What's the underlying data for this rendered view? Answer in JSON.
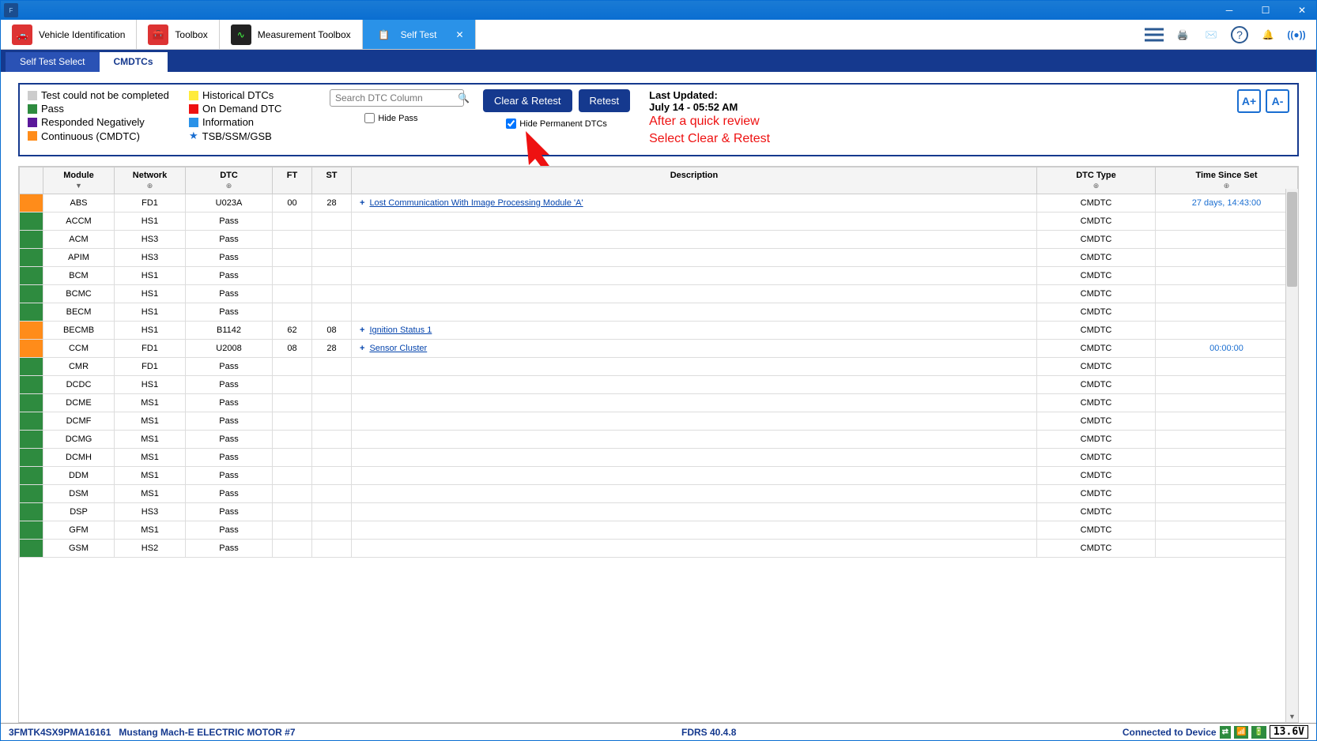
{
  "titlebar": {
    "title": ""
  },
  "ribbon": {
    "tabs": [
      {
        "label": "Vehicle Identification"
      },
      {
        "label": "Toolbox"
      },
      {
        "label": "Measurement Toolbox"
      },
      {
        "label": "Self Test"
      }
    ]
  },
  "subtabs": [
    {
      "label": "Self Test Select",
      "active": false
    },
    {
      "label": "CMDTCs",
      "active": true
    }
  ],
  "legend": {
    "items": [
      {
        "color": "#cccccc",
        "label": "Test could not be completed"
      },
      {
        "color": "#ffeb3b",
        "label": "Historical DTCs"
      },
      {
        "color": "#2e8b3f",
        "label": "Pass"
      },
      {
        "color": "#e11",
        "label": "On Demand DTC"
      },
      {
        "color": "#5a189a",
        "label": "Responded Negatively"
      },
      {
        "color": "#2a92e8",
        "label": "Information"
      },
      {
        "color": "#ff8c1a",
        "label": "Continuous (CMDTC)"
      },
      {
        "color": "star",
        "label": "TSB/SSM/GSB"
      }
    ]
  },
  "search": {
    "placeholder": "Search DTC Column"
  },
  "buttons": {
    "clear_retest": "Clear & Retest",
    "retest": "Retest"
  },
  "checks": {
    "hide_pass": "Hide Pass",
    "hide_perm": "Hide Permanent DTCs"
  },
  "updated": {
    "label": "Last Updated:",
    "value": "July 14 - 05:52 AM"
  },
  "annotation": {
    "line1": "After a quick review",
    "line2": "Select Clear & Retest"
  },
  "fontsize": {
    "plus": "A+",
    "minus": "A-"
  },
  "columns": [
    "",
    "Module",
    "Network",
    "DTC",
    "FT",
    "ST",
    "Description",
    "DTC Type",
    "Time Since Set"
  ],
  "column_sort_marks": [
    "",
    "▼",
    "⊕",
    "⊕",
    "",
    "",
    "",
    "⊕",
    "⊕"
  ],
  "rows": [
    {
      "status": "orange",
      "module": "ABS",
      "network": "FD1",
      "dtc": "U023A",
      "ft": "00",
      "st": "28",
      "desc": "Lost Communication With Image Processing Module 'A'",
      "link": true,
      "type": "CMDTC",
      "time": "27 days, 14:43:00"
    },
    {
      "status": "green",
      "module": "ACCM",
      "network": "HS1",
      "dtc": "Pass",
      "ft": "",
      "st": "",
      "desc": "",
      "link": false,
      "type": "CMDTC",
      "time": ""
    },
    {
      "status": "green",
      "module": "ACM",
      "network": "HS3",
      "dtc": "Pass",
      "ft": "",
      "st": "",
      "desc": "",
      "link": false,
      "type": "CMDTC",
      "time": ""
    },
    {
      "status": "green",
      "module": "APIM",
      "network": "HS3",
      "dtc": "Pass",
      "ft": "",
      "st": "",
      "desc": "",
      "link": false,
      "type": "CMDTC",
      "time": ""
    },
    {
      "status": "green",
      "module": "BCM",
      "network": "HS1",
      "dtc": "Pass",
      "ft": "",
      "st": "",
      "desc": "",
      "link": false,
      "type": "CMDTC",
      "time": ""
    },
    {
      "status": "green",
      "module": "BCMC",
      "network": "HS1",
      "dtc": "Pass",
      "ft": "",
      "st": "",
      "desc": "",
      "link": false,
      "type": "CMDTC",
      "time": ""
    },
    {
      "status": "green",
      "module": "BECM",
      "network": "HS1",
      "dtc": "Pass",
      "ft": "",
      "st": "",
      "desc": "",
      "link": false,
      "type": "CMDTC",
      "time": ""
    },
    {
      "status": "orange",
      "module": "BECMB",
      "network": "HS1",
      "dtc": "B1142",
      "ft": "62",
      "st": "08",
      "desc": "Ignition Status 1",
      "link": true,
      "type": "CMDTC",
      "time": ""
    },
    {
      "status": "orange",
      "module": "CCM",
      "network": "FD1",
      "dtc": "U2008",
      "ft": "08",
      "st": "28",
      "desc": "Sensor Cluster",
      "link": true,
      "type": "CMDTC",
      "time": "00:00:00"
    },
    {
      "status": "green",
      "module": "CMR",
      "network": "FD1",
      "dtc": "Pass",
      "ft": "",
      "st": "",
      "desc": "",
      "link": false,
      "type": "CMDTC",
      "time": ""
    },
    {
      "status": "green",
      "module": "DCDC",
      "network": "HS1",
      "dtc": "Pass",
      "ft": "",
      "st": "",
      "desc": "",
      "link": false,
      "type": "CMDTC",
      "time": ""
    },
    {
      "status": "green",
      "module": "DCME",
      "network": "MS1",
      "dtc": "Pass",
      "ft": "",
      "st": "",
      "desc": "",
      "link": false,
      "type": "CMDTC",
      "time": ""
    },
    {
      "status": "green",
      "module": "DCMF",
      "network": "MS1",
      "dtc": "Pass",
      "ft": "",
      "st": "",
      "desc": "",
      "link": false,
      "type": "CMDTC",
      "time": ""
    },
    {
      "status": "green",
      "module": "DCMG",
      "network": "MS1",
      "dtc": "Pass",
      "ft": "",
      "st": "",
      "desc": "",
      "link": false,
      "type": "CMDTC",
      "time": ""
    },
    {
      "status": "green",
      "module": "DCMH",
      "network": "MS1",
      "dtc": "Pass",
      "ft": "",
      "st": "",
      "desc": "",
      "link": false,
      "type": "CMDTC",
      "time": ""
    },
    {
      "status": "green",
      "module": "DDM",
      "network": "MS1",
      "dtc": "Pass",
      "ft": "",
      "st": "",
      "desc": "",
      "link": false,
      "type": "CMDTC",
      "time": ""
    },
    {
      "status": "green",
      "module": "DSM",
      "network": "MS1",
      "dtc": "Pass",
      "ft": "",
      "st": "",
      "desc": "",
      "link": false,
      "type": "CMDTC",
      "time": ""
    },
    {
      "status": "green",
      "module": "DSP",
      "network": "HS3",
      "dtc": "Pass",
      "ft": "",
      "st": "",
      "desc": "",
      "link": false,
      "type": "CMDTC",
      "time": ""
    },
    {
      "status": "green",
      "module": "GFM",
      "network": "MS1",
      "dtc": "Pass",
      "ft": "",
      "st": "",
      "desc": "",
      "link": false,
      "type": "CMDTC",
      "time": ""
    },
    {
      "status": "green",
      "module": "GSM",
      "network": "HS2",
      "dtc": "Pass",
      "ft": "",
      "st": "",
      "desc": "",
      "link": false,
      "type": "CMDTC",
      "time": ""
    }
  ],
  "footer": {
    "vin": "3FMTK4SX9PMA16161",
    "vehicle": "Mustang Mach-E ELECTRIC MOTOR #7",
    "version": "FDRS 40.4.8",
    "conn": "Connected to Device",
    "voltage": "13.6V"
  }
}
